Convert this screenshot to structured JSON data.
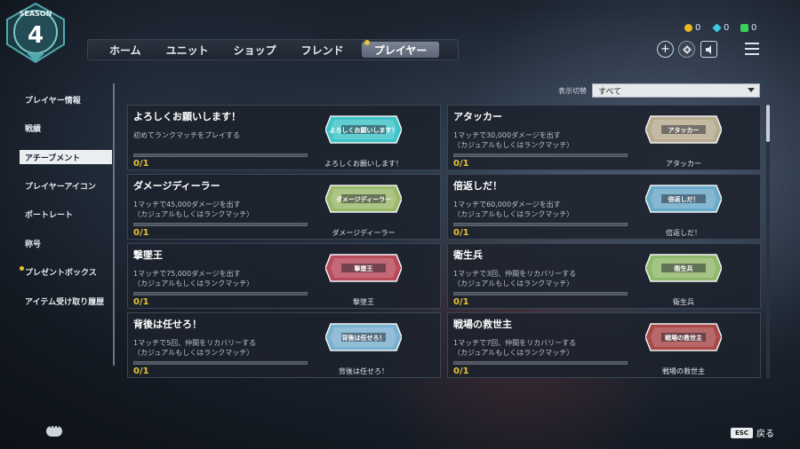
{
  "season": {
    "label": "SEASON",
    "number": "4"
  },
  "nav": {
    "tabs": [
      {
        "label": "ホーム"
      },
      {
        "label": "ユニット"
      },
      {
        "label": "ショップ"
      },
      {
        "label": "フレンド"
      },
      {
        "label": "プレイヤー"
      }
    ]
  },
  "currencies": [
    {
      "icon": "gold-coin-icon",
      "value": "0",
      "color": "#e8b923"
    },
    {
      "icon": "blue-gem-icon",
      "value": "0",
      "color": "#3cc9e8"
    },
    {
      "icon": "green-cube-icon",
      "value": "0",
      "color": "#3ad15a"
    }
  ],
  "sidebar": {
    "items": [
      {
        "label": "プレイヤー情報"
      },
      {
        "label": "戦績"
      },
      {
        "label": "アチーブメント"
      },
      {
        "label": "プレイヤーアイコン"
      },
      {
        "label": "ポートレート"
      },
      {
        "label": "称号"
      },
      {
        "label": "プレゼントボックス"
      },
      {
        "label": "アイテム受け取り履歴"
      }
    ]
  },
  "filter": {
    "label": "表示切替",
    "value": "すべて"
  },
  "achievements": [
    {
      "title": "よろしくお願いします！",
      "desc": "初めてランクマッチをプレイする",
      "progress": "0/1",
      "plate": "よろしくお願いします！",
      "color": "#3fc4c9"
    },
    {
      "title": "アタッカー",
      "desc": "1マッチで30,000ダメージを出す\n（カジュアルもしくはランクマッチ）",
      "progress": "0/1",
      "plate": "アタッカー",
      "color": "#b8ab90"
    },
    {
      "title": "ダメージディーラー",
      "desc": "1マッチで45,000ダメージを出す\n（カジュアルもしくはランクマッチ）",
      "progress": "0/1",
      "plate": "ダメージディーラー",
      "color": "#9ab86a"
    },
    {
      "title": "倍返しだ！",
      "desc": "1マッチで60,000ダメージを出す\n（カジュアルもしくはランクマッチ）",
      "progress": "0/1",
      "plate": "倍返しだ！",
      "color": "#6aa9c8"
    },
    {
      "title": "撃墜王",
      "desc": "1マッチで75,000ダメージを出す\n（カジュアルもしくはランクマッチ）",
      "progress": "0/1",
      "plate": "撃墜王",
      "color": "#b84a5a"
    },
    {
      "title": "衛生兵",
      "desc": "1マッチで3回、仲間をリカバリーする\n（カジュアルもしくはランクマッチ）",
      "progress": "0/1",
      "plate": "衛生兵",
      "color": "#8fb86a"
    },
    {
      "title": "背後は任せろ！",
      "desc": "1マッチで5回、仲間をリカバリーする\n（カジュアルもしくはランクマッチ）",
      "progress": "0/1",
      "plate": "背後は任せろ！",
      "color": "#7ab0cf"
    },
    {
      "title": "戦場の救世主",
      "desc": "1マッチで7回、仲間をリカバリーする\n（カジュアルもしくはランクマッチ）",
      "progress": "0/1",
      "plate": "戦場の救世主",
      "color": "#a84848"
    }
  ],
  "footer": {
    "esc_key": "ESC",
    "back_label": "戻る"
  }
}
